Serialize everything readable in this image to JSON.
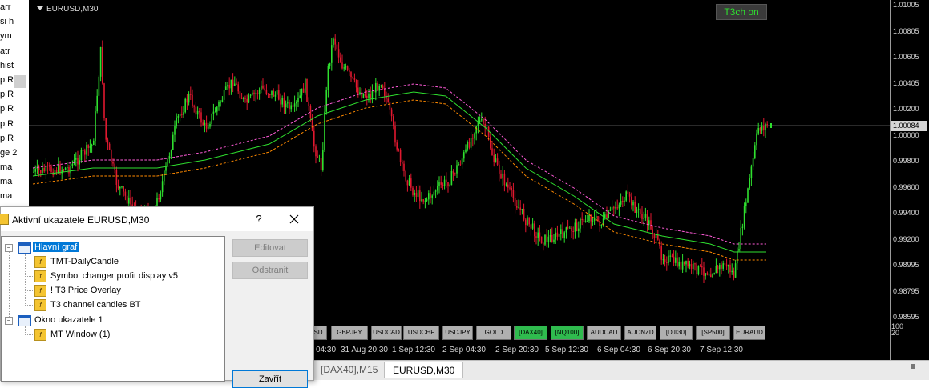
{
  "left_list": {
    "items": [
      "arr",
      "si h",
      "ym",
      "atr",
      "hist",
      "p R",
      "p R",
      "p R",
      "p R",
      "p R",
      "ge 2",
      "ma",
      "ma",
      "ma"
    ]
  },
  "chart": {
    "title": "EURUSD,M30",
    "t3_button": "T3ch on",
    "current_price": "1.00084",
    "price_labels": [
      "1.01005",
      "1.00805",
      "1.00605",
      "1.00405",
      "1.00200",
      "1.00000",
      "0.99800",
      "0.99600",
      "0.99400",
      "0.99200",
      "0.98995",
      "0.98795",
      "0.98595"
    ],
    "time_labels": [
      "04:30",
      "31 Aug 20:30",
      "1 Sep 12:30",
      "2 Sep 04:30",
      "2 Sep 20:30",
      "5 Sep 12:30",
      "6 Sep 04:30",
      "6 Sep 20:30",
      "7 Sep 12:30"
    ],
    "indicator_scale": [
      "100",
      "20"
    ],
    "colors": {
      "bull": "#2fe02f",
      "bear": "#e0182f",
      "upper_band": "#ff5bd8",
      "mid_band": "#2fe02f",
      "lower_band": "#ff8a00",
      "background": "#000000"
    }
  },
  "symbol_buttons": [
    {
      "label": "SD",
      "active": false
    },
    {
      "label": "GBPJPY",
      "active": false
    },
    {
      "label": "USDCAD",
      "active": false
    },
    {
      "label": "USDCHF",
      "active": false
    },
    {
      "label": "USDJPY",
      "active": false
    },
    {
      "label": "GOLD",
      "active": false
    },
    {
      "label": "[DAX40]",
      "active": true
    },
    {
      "label": "[NQ100]",
      "active": true
    },
    {
      "label": "AUDCAD",
      "active": false
    },
    {
      "label": "AUDNZD",
      "active": false
    },
    {
      "label": "[DJI30]",
      "active": false
    },
    {
      "label": "[SP500]",
      "active": false
    },
    {
      "label": "EURAUD",
      "active": false
    }
  ],
  "tabs": {
    "dax": "[DAX40],M15",
    "eurusd": "EURUSD,M30"
  },
  "dialog": {
    "title": "Aktivní ukazatele EURUSD,M30",
    "help": "?",
    "tree": {
      "main": "Hlavní graf",
      "main_items": [
        "TMT-DailyCandle",
        "Symbol changer profit display v5",
        "! T3 Price Overlay",
        "T3 channel candles BT"
      ],
      "sub": "Okno ukazatele 1",
      "sub_items": [
        "MT Window (1)"
      ]
    },
    "buttons": {
      "edit": "Editovat",
      "remove": "Odstranit",
      "close": "Zavřít"
    }
  }
}
